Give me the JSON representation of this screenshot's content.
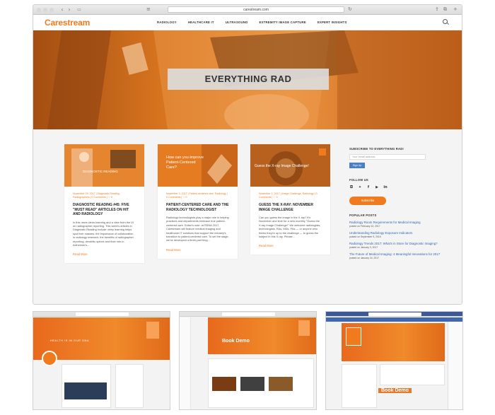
{
  "browser": {
    "url": "carestream.com"
  },
  "site": {
    "logo": "Carestream",
    "nav": [
      "RADIOLOGY",
      "HEALTHCARE IT",
      "ULTRASOUND",
      "EXTREMITY IMAGE CAPTURE",
      "EXPERT INSIGHTS"
    ]
  },
  "hero": {
    "title": "EVERYTHING RAD"
  },
  "cards": [
    {
      "image_caption": "DIAGNOSTIC READING",
      "meta": "November 29, 2017 | Diagnostic Reading, Radiographers | 0 Comments | ♡ 0",
      "title": "DIAGNOSTIC READING #45: FIVE \"MUST READ\" ARTICLES ON HIT AND RADIOLOGY",
      "excerpt": "In this news clean-learning and a view from the UI on radiographer reporting. This week's articles in Diagnostic Reading include: deep learning helps spot liver masses; the importance of collaboration in radiology research; the benefits of radiographer reporting; dendritic spines and their role in Alzheimer's...",
      "readmore": "Read More"
    },
    {
      "image_caption": "How can you improve Patient-Centered Care?",
      "meta": "November 3, 2017 | Patient-centered care, Radiology | 0 Comments | ♡ 0",
      "title": "PATIENT-CENTERED CARE AND THE RADIOLOGY TECHNOLOGIST",
      "excerpt": "Radiology technologists play a major role in helping practices and departments embrace true patient-centered care. Editor's note: at RSNA 2017, Carestream will feature medical imaging and healthcare IT solutions that support the industry's transition to patient-centered care. To set the stage, we've developed a three-part blog...",
      "readmore": "Read More"
    },
    {
      "image_caption": "Guess the X-ray Image Challenge!",
      "meta": "November 1, 2017 | Image Challenge, Radiology | 0 Comments | ♡ 0",
      "title": "GUESS THE X-RAY: NOVEMBER IMAGE CHALLENGE",
      "excerpt": "Can you guess the image in the X-ray? It's November and time for a new monthly \"Guess the X-ray Image Challenge!\" We welcome radiologists, technologists, RAs, MDs, PAs — or anyone who thinks they're up to the challenge — to guess the subject in this X-ray. Please...",
      "readmore": "Read More"
    }
  ],
  "sidebar": {
    "subscribe_heading": "SUBSCRIBE TO EVERYTHING RAD!",
    "email_placeholder": "Your email address",
    "signup_label": "Sign Up",
    "follow_heading": "FOLLOW US",
    "social_icons": [
      "instagram-icon",
      "twitter-icon",
      "facebook-icon",
      "youtube-icon",
      "linkedin-icon"
    ],
    "subscribe_label": "Subscribe",
    "popular_heading": "POPULAR POSTS",
    "posts": [
      {
        "title": "Radiology Room Requirements for Medical Imaging",
        "date": "posted on February 14, 2017"
      },
      {
        "title": "Understanding Radiology Exposure Indicators",
        "date": "posted on September 9, 2016"
      },
      {
        "title": "Radiology Trends 2017: What's in Store for Diagnostic Imaging?",
        "date": "posted on January 3, 2017"
      },
      {
        "title": "The Future of Medical Imaging: 4 Meaningful Innovations for 2017",
        "date": "posted on January 24, 2017"
      }
    ]
  },
  "thumbnails": {
    "t1": {
      "banner_text": "HEALTH IS IN OUR DNA"
    },
    "t2": {
      "banner_text": "Book Demo"
    },
    "t3": {
      "banner_text": "Book Demo"
    }
  },
  "colors": {
    "brand": "#f07b1e",
    "link": "#2f66b5",
    "signup": "#4a7fc1"
  }
}
